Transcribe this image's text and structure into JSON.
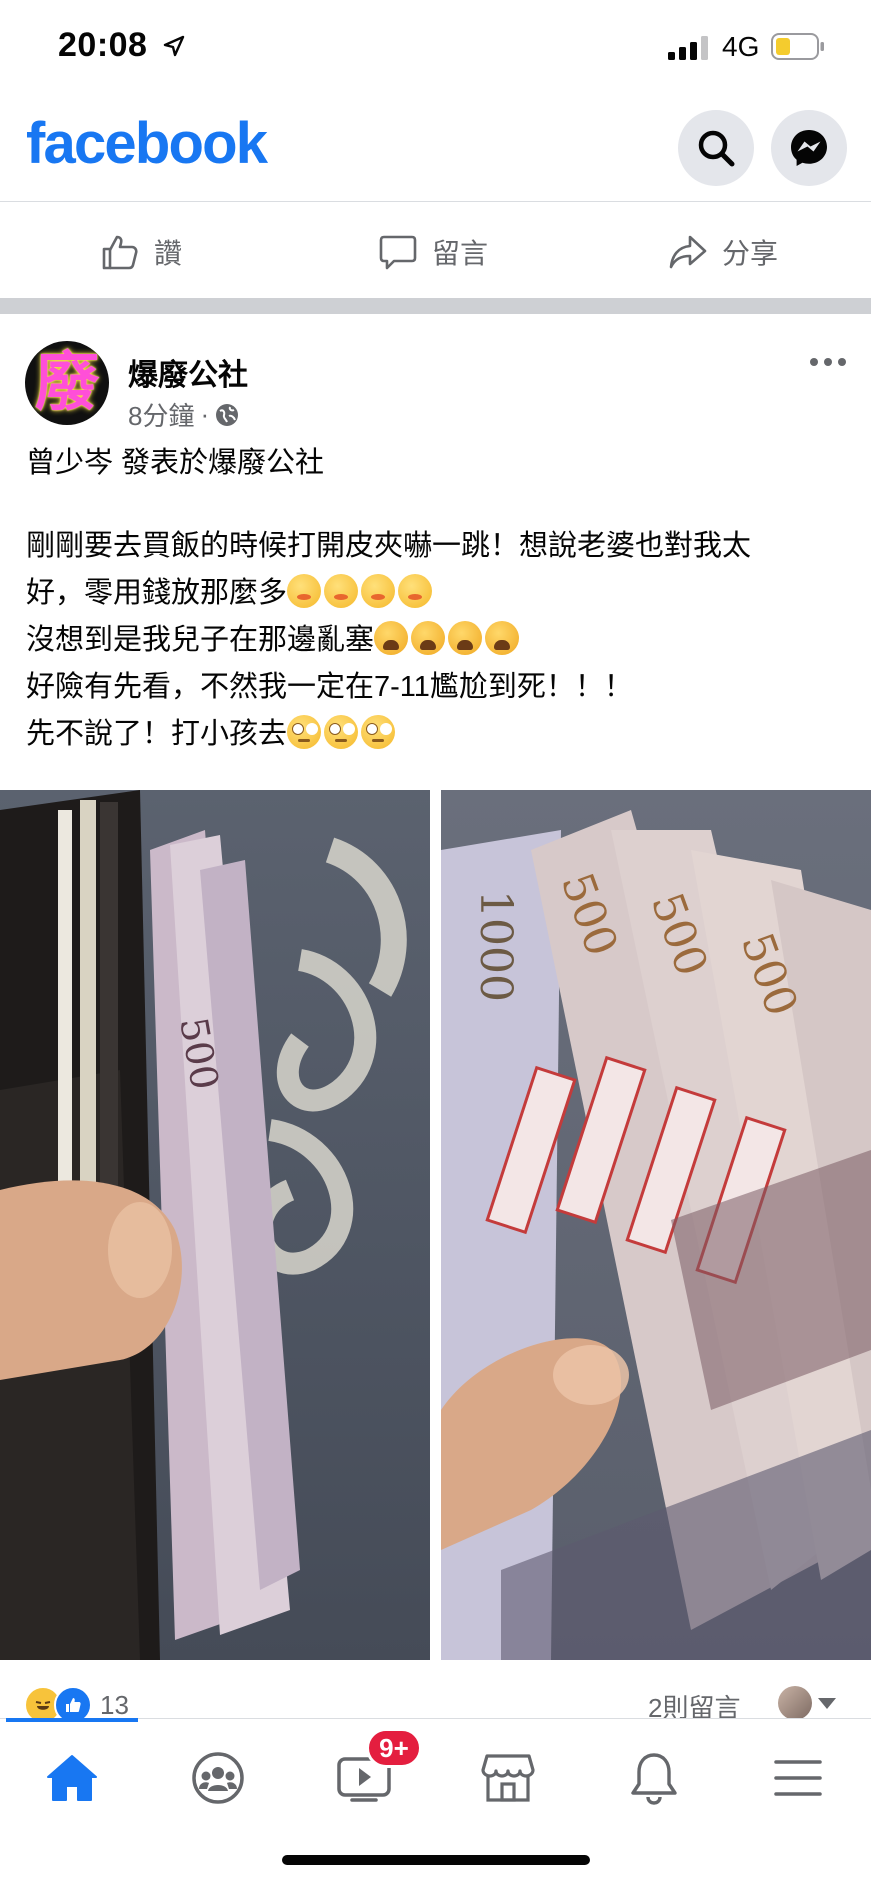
{
  "status_bar": {
    "time": "20:08",
    "network": "4G"
  },
  "header": {
    "logo": "facebook"
  },
  "action_bar": {
    "like": "讚",
    "comment": "留言",
    "share": "分享"
  },
  "post": {
    "page_name": "爆廢公社",
    "avatar_glyph": "廢",
    "time_ago": "8分鐘",
    "separator": "·",
    "author_line": "曾少岑 發表於爆廢公社",
    "body": {
      "line1": "剛剛要去買飯的時候打開皮夾嚇一跳！想說老婆也對我太",
      "line2": "好，零用錢放那麼多",
      "line3": "沒想到是我兒子在那邊亂塞",
      "line4": "好險有先看，不然我一定在7-11尷尬到死！！！",
      "line5": "先不說了！打小孩去"
    },
    "photos": [
      {
        "description_icon": "wallet-photo"
      },
      {
        "description_icon": "banknotes-photo"
      }
    ],
    "reaction_count": "13",
    "comment_count": "2則留言"
  },
  "tab_bar": {
    "tabs": [
      "home",
      "groups",
      "watch",
      "marketplace",
      "notifications",
      "menu"
    ],
    "watch_badge": "9+",
    "active_color": "#1877f2"
  }
}
